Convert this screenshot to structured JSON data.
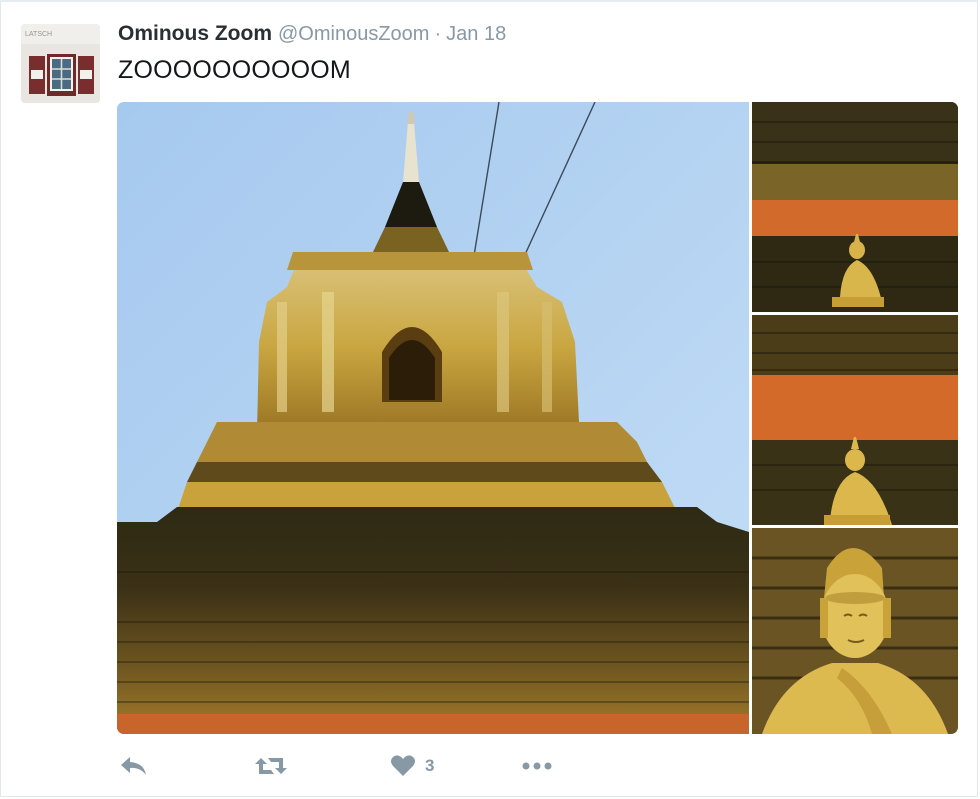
{
  "tweet": {
    "author_name": "Ominous Zoom",
    "author_handle": "@OminousZoom",
    "separator": "·",
    "date": "Jan 18",
    "text": "ZOOOOOOOOOOM",
    "avatar_sign_text": "LATSCH",
    "like_count": "3"
  },
  "media": {
    "photos": [
      {
        "name": "temple-stupa-photo"
      },
      {
        "name": "buddha-far-photo"
      },
      {
        "name": "buddha-mid-photo"
      },
      {
        "name": "buddha-close-photo"
      }
    ]
  },
  "actions": [
    {
      "name": "reply-button",
      "icon": "reply-icon"
    },
    {
      "name": "retweet-button",
      "icon": "retweet-icon"
    },
    {
      "name": "like-button",
      "icon": "heart-icon"
    },
    {
      "name": "more-button",
      "icon": "more-dots-icon"
    }
  ],
  "colors": {
    "icon_gray": "#8899a6",
    "text_dark": "#292f33",
    "sky": "#a9cdf2",
    "gold": "#c9a137",
    "orange_band": "#d26a2c"
  }
}
